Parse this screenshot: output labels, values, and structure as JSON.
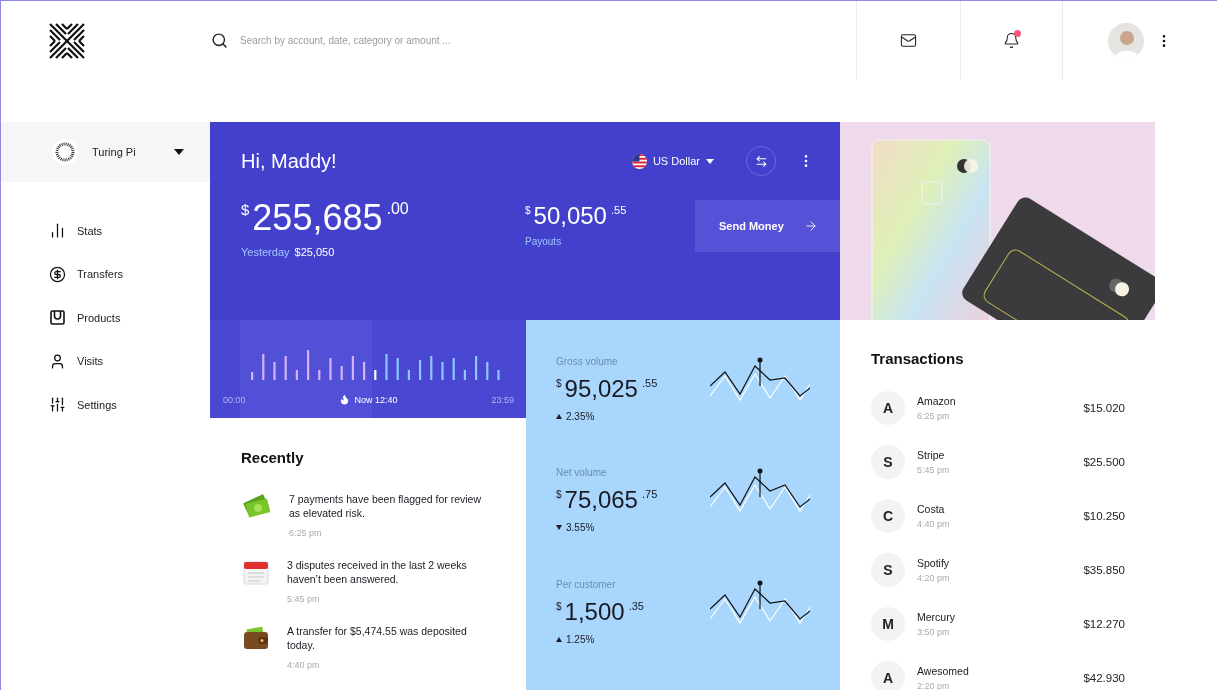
{
  "header": {
    "search": {
      "placeholder": "Search by account, date, category or amount ..."
    },
    "notifications": {
      "unread": true
    }
  },
  "account": {
    "name": "Turing Pi"
  },
  "nav": [
    {
      "kind": "stats",
      "label": "Stats"
    },
    {
      "kind": "transfers",
      "label": "Transfers"
    },
    {
      "kind": "products",
      "label": "Products"
    },
    {
      "kind": "visits",
      "label": "Visits"
    },
    {
      "kind": "settings",
      "label": "Settings"
    }
  ],
  "hero": {
    "greeting": "Hi, Maddy!",
    "currency": "US Dollar",
    "balance": {
      "symbol": "$",
      "whole": "255,685",
      "cents": ".00"
    },
    "yesterday_label": "Yesterday",
    "yesterday_value": "$25,050",
    "payouts": {
      "symbol": "$",
      "whole": "50,050",
      "cents": ".55",
      "label": "Payouts"
    },
    "send_button": "Send Money"
  },
  "timeline": {
    "start": "00:00",
    "now": "Now 12:40",
    "end": "23:59"
  },
  "metrics": [
    {
      "label": "Gross volume",
      "symbol": "$",
      "whole": "95,025",
      "cents": ".55",
      "kind": "up",
      "change": "2.35%"
    },
    {
      "label": "Net volume",
      "symbol": "$",
      "whole": "75,065",
      "cents": ".75",
      "kind": "down",
      "change": "3.55%"
    },
    {
      "label": "Per customer",
      "symbol": "$",
      "whole": "1,500",
      "cents": ".35",
      "kind": "up",
      "change": "1.25%"
    }
  ],
  "recently": {
    "title": "Recently",
    "items": [
      {
        "kind": "money",
        "text": "7 payments have been flagged for review as elevated risk.",
        "time": "6:25 pm"
      },
      {
        "kind": "calendar",
        "text": "3 disputes received in the last 2 weeks haven’t been answered.",
        "time": "5:45 pm"
      },
      {
        "kind": "wallet",
        "text": "A transfer for $5,474.55 was deposited today.",
        "time": "4:40 pm"
      }
    ]
  },
  "transactions": {
    "title": "Transactions",
    "items": [
      {
        "initial": "A",
        "name": "Amazon",
        "time": "6:25 pm",
        "amount": "$15.020"
      },
      {
        "initial": "S",
        "name": "Stripe",
        "time": "5:45 pm",
        "amount": "$25.500"
      },
      {
        "initial": "C",
        "name": "Costa",
        "time": "4:40 pm",
        "amount": "$10.250"
      },
      {
        "initial": "S",
        "name": "Spotify",
        "time": "4:20 pm",
        "amount": "$35.850"
      },
      {
        "initial": "M",
        "name": "Mercury",
        "time": "3:50 pm",
        "amount": "$12.270"
      },
      {
        "initial": "A",
        "name": "Awesomed",
        "time": "2:20 pm",
        "amount": "$42.930"
      }
    ]
  }
}
